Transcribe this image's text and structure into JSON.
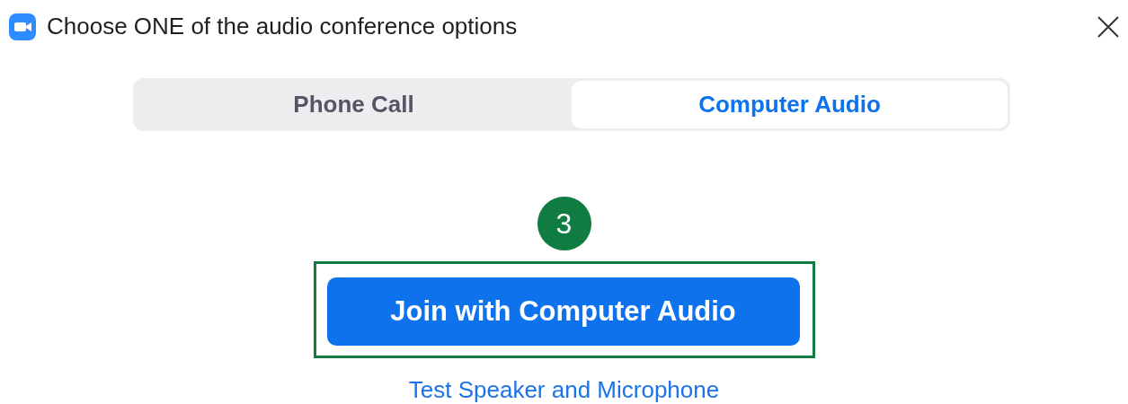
{
  "window": {
    "title": "Choose ONE of the audio conference options"
  },
  "tabs": [
    {
      "label": "Phone Call",
      "selected": false
    },
    {
      "label": "Computer Audio",
      "selected": true
    }
  ],
  "step_badge": {
    "label": "3"
  },
  "join_button": {
    "label": "Join with Computer Audio",
    "highlighted": true
  },
  "test_link": {
    "label": "Test Speaker and Microphone"
  }
}
